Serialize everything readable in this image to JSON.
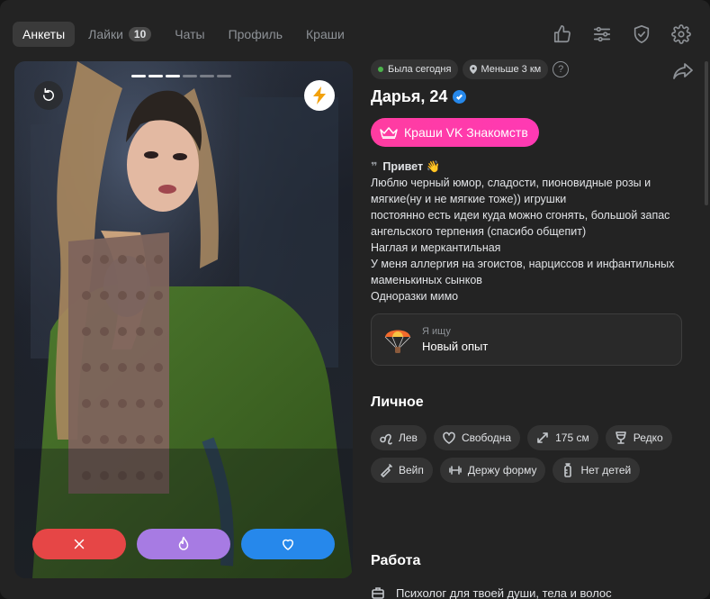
{
  "nav": {
    "tabs": [
      {
        "label": "Анкеты",
        "active": true
      },
      {
        "label": "Лайки",
        "count": "10"
      },
      {
        "label": "Чаты"
      },
      {
        "label": "Профиль"
      },
      {
        "label": "Краши"
      }
    ],
    "icons": [
      "thumbs-up-icon",
      "filters-icon",
      "shield-icon",
      "settings-icon"
    ]
  },
  "photo": {
    "slides_total": 6,
    "slides_active": 3,
    "actions": [
      "dislike-icon",
      "super-like-flame-icon",
      "like-heart-icon"
    ],
    "colors": {
      "dislike": "#e64646",
      "super": "#a77be3",
      "like": "#2688eb"
    }
  },
  "profile": {
    "status": "Была сегодня",
    "distance": "Меньше 3 км",
    "help": "?",
    "name_age": "Дарья, 24",
    "verified": true,
    "crush_badge": "Краши VK Знакомств",
    "bio": {
      "greeting": "Привет 👋",
      "lines": [
        "Люблю черный юмор, сладости, пионовидные розы и мягкие(ну и не мягкие тоже)) игрушки",
        "постоянно есть идеи куда можно сгонять, большой запас ангельского терпения (спасибо общепит)",
        "Наглая и меркантильная",
        "У меня аллергия на эгоистов, нарциссов и инфантильных маменькиных сынков",
        "Одноразки мимо"
      ]
    },
    "seeking": {
      "label": "Я ищу",
      "value": "Новый опыт"
    },
    "personal": {
      "title": "Личное",
      "tags": [
        {
          "icon": "leo-zodiac-icon",
          "label": "Лев"
        },
        {
          "icon": "heart-outline-icon",
          "label": "Свободна"
        },
        {
          "icon": "height-arrows-icon",
          "label": "175 см"
        },
        {
          "icon": "glass-icon",
          "label": "Редко"
        },
        {
          "icon": "vape-icon",
          "label": "Вейп"
        },
        {
          "icon": "dumbbell-icon",
          "label": "Держу форму"
        },
        {
          "icon": "baby-bottle-icon",
          "label": "Нет детей"
        }
      ]
    },
    "work": {
      "title": "Работа",
      "value": "Психолог для твоей души, тела и волос"
    }
  }
}
